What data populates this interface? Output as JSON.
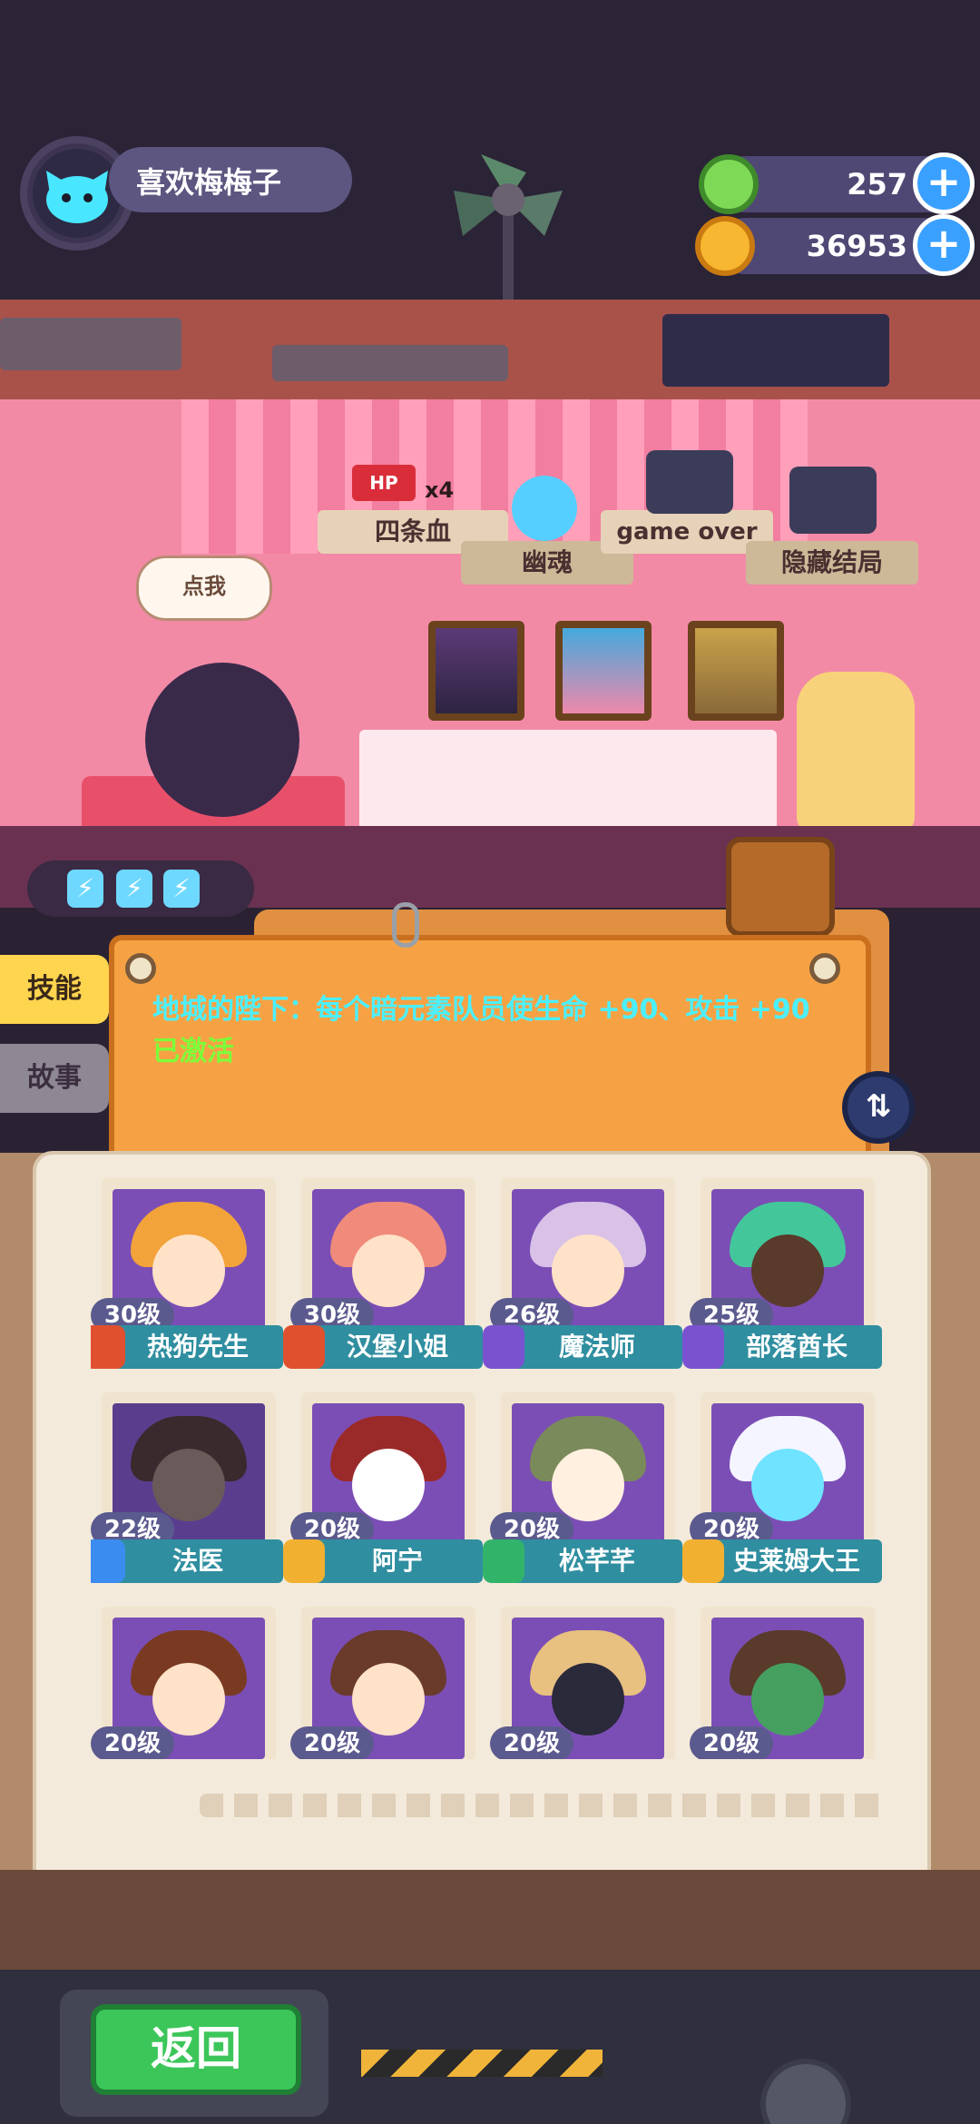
{
  "player": {
    "name": "喜欢梅梅子"
  },
  "resources": [
    {
      "name": "gem-currency",
      "value": "257",
      "color": "#7ed957"
    },
    {
      "name": "coin-currency",
      "value": "36953",
      "color": "#f7b731"
    }
  ],
  "room": {
    "talk_bubble": "点我",
    "signs": {
      "four_hp": "四条血",
      "hp_tag": "HP",
      "hp_multiplier": "x4",
      "ghost": "幽魂",
      "game_over": "game over",
      "hidden_ending": "隐藏结局"
    },
    "energy_count": 3,
    "energy_glyph": "⚡"
  },
  "tabs": {
    "skill": "技能",
    "story": "故事"
  },
  "skill_note": {
    "text": "地城的陛下：每个暗元素队员使生命 +90、攻击 +90",
    "status": "已激活"
  },
  "heroes": [
    {
      "name": "热狗先生",
      "level": "30级",
      "badge": "#e0502e",
      "port": "#7b4eb5",
      "hair": "#f2a33a",
      "face": "#ffe2c8"
    },
    {
      "name": "汉堡小姐",
      "level": "30级",
      "badge": "#e0502e",
      "port": "#7b4eb5",
      "hair": "#f08a7a",
      "face": "#ffe2c8"
    },
    {
      "name": "魔法师",
      "level": "26级",
      "badge": "#7a52d0",
      "port": "#7b4eb5",
      "hair": "#d9c1e8",
      "face": "#ffe2c8"
    },
    {
      "name": "部落酋长",
      "level": "25级",
      "badge": "#7a52d0",
      "port": "#7b4eb5",
      "hair": "#43c79a",
      "face": "#5a3a2a"
    },
    {
      "name": "法医",
      "level": "22级",
      "badge": "#3a8cf0",
      "port": "#5a3e8e",
      "hair": "#3a2a2e",
      "face": "#6a5a5a"
    },
    {
      "name": "阿宁",
      "level": "20级",
      "badge": "#f2b030",
      "port": "#7b4eb5",
      "hair": "#9a2a2a",
      "face": "#ffffff"
    },
    {
      "name": "松芊芊",
      "level": "20级",
      "badge": "#32b36a",
      "port": "#7b4eb5",
      "hair": "#7a8a5a",
      "face": "#fff0e0"
    },
    {
      "name": "史莱姆大王",
      "level": "20级",
      "badge": "#f2b030",
      "port": "#7b4eb5",
      "hair": "#f5f5ff",
      "face": "#6fe3ff"
    },
    {
      "name": "",
      "level": "20级",
      "badge": "#f2b030",
      "port": "#7b4eb5",
      "hair": "#7a3a22",
      "face": "#ffe2c8"
    },
    {
      "name": "",
      "level": "20级",
      "badge": "#f2b030",
      "port": "#7b4eb5",
      "hair": "#6a3a2a",
      "face": "#ffe2c8"
    },
    {
      "name": "",
      "level": "20级",
      "badge": "#f2b030",
      "port": "#7b4eb5",
      "hair": "#e8c080",
      "face": "#2a2a3a"
    },
    {
      "name": "",
      "level": "20级",
      "badge": "#f2b030",
      "port": "#7b4eb5",
      "hair": "#5a3a2a",
      "face": "#45a060"
    }
  ],
  "footer": {
    "back_label": "返回"
  }
}
